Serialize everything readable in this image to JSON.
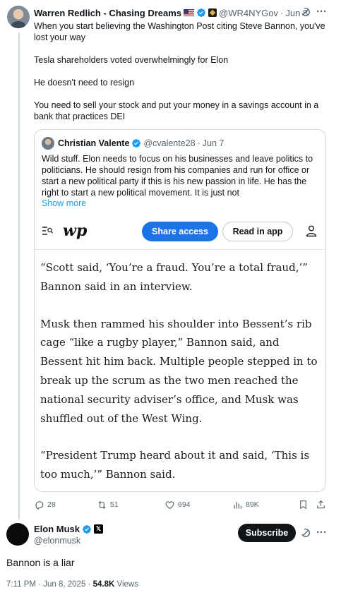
{
  "tweet1": {
    "author_name": "Warren Redlich - Chasing Dreams",
    "handle": "@WR4NYGov",
    "separator": "·",
    "date": "Jun 8",
    "paragraphs": [
      "When you start believing the Washington Post citing Steve Bannon, you've lost your way",
      "Tesla shareholders voted overwhelmingly for Elon",
      "He doesn't need to resign",
      "You need to sell your stock and put your money in a savings account in a bank that practices DEI"
    ]
  },
  "quote": {
    "author_name": "Christian Valente",
    "handle": "@cvalente28",
    "separator": "·",
    "date": "Jun 7",
    "text": "Wild stuff. Elon needs to focus on his businesses and leave politics to politicians. He should resign from his companies and run for office or start a new political party if this is his new passion in life. He has the right to start a new political movement. It is just not",
    "show_more": "Show more",
    "image": {
      "logo_text": "wp",
      "share_button": "Share access",
      "read_button": "Read in app",
      "article_paragraphs": [
        "“Scott said, ‘You’re a fraud. You’re a total fraud,’” Bannon said in an interview.",
        "Musk then rammed his shoulder into Bessent’s rib cage “like a rugby player,” Bannon said, and Bessent hit him back. Multiple people stepped in to break up the scrum as the two men reached the national security adviser’s office, and Musk was shuffled out of the West Wing.",
        "“President Trump heard about it and said, ‘This is too much,’” Bannon said."
      ]
    }
  },
  "actions": {
    "replies": "28",
    "reposts": "51",
    "likes": "694",
    "views": "89K"
  },
  "tweet2": {
    "author_name": "Elon Musk",
    "handle": "@elonmusk",
    "subscribe_label": "Subscribe",
    "text": "Bannon is a liar",
    "time": "7:11 PM",
    "separator": "·",
    "date": "Jun 8, 2025",
    "dot": "·",
    "views_count": "54.8K",
    "views_label": "Views"
  },
  "colors": {
    "verified_blue": "#1d9bf0",
    "wp_share_blue": "#1a74e8",
    "secondary_text": "#536471"
  },
  "icons": [
    "verified-icon",
    "flag-us-icon",
    "affiliate-badge-icon",
    "grok-icon",
    "more-icon",
    "reply-icon",
    "repost-icon",
    "like-icon",
    "views-icon",
    "bookmark-icon",
    "share-icon",
    "menu-search-icon",
    "user-icon",
    "x-badge-icon"
  ]
}
